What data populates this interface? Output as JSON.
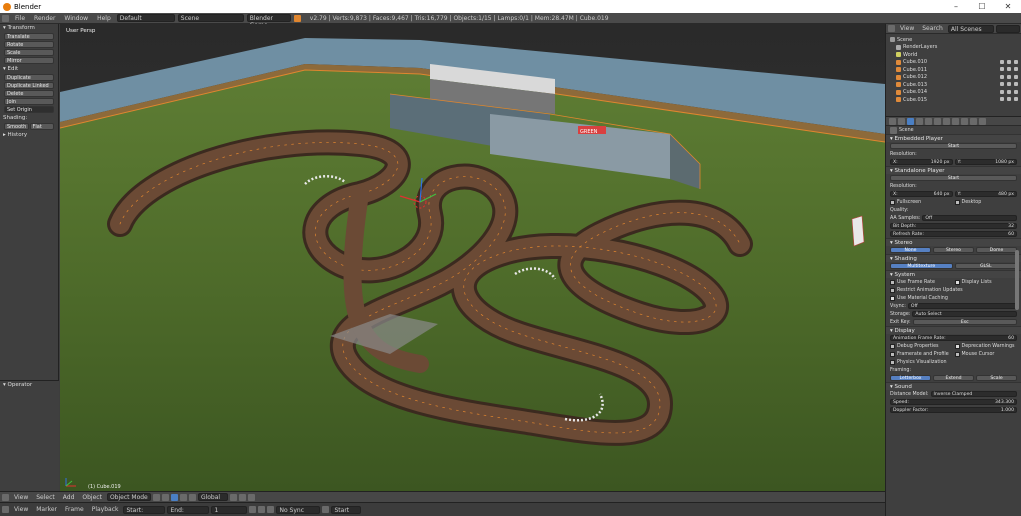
{
  "window": {
    "title": "Blender",
    "controls": [
      "–",
      "☐",
      "✕"
    ]
  },
  "infobar": {
    "menus": [
      "File",
      "Render",
      "Window",
      "Help"
    ],
    "layout": "Default",
    "scene": "Scene",
    "engine": "Blender Game",
    "stats": "v2.79 | Verts:9,873 | Faces:9,467 | Tris:16,779 | Objects:1/15 | Lamps:0/1 | Mem:28.47M | Cube.019"
  },
  "toolshelf": {
    "transform_header": "▾ Transform",
    "transform": [
      "Translate",
      "Rotate",
      "Scale",
      "Mirror"
    ],
    "edit_header": "▾ Edit",
    "edit": [
      "Duplicate",
      "Duplicate Linked",
      "Delete",
      "Join",
      "Set Origin"
    ],
    "shading_label": "Shading:",
    "shading": [
      "Smooth",
      "Flat"
    ],
    "history_header": "▸ History",
    "operator_header": "▾ Operator"
  },
  "viewport": {
    "label": "User Persp",
    "object": "(1) Cube.019",
    "banner": "GREEN"
  },
  "header": {
    "menus": [
      "View",
      "Select",
      "Add",
      "Object"
    ],
    "mode": "Object Mode",
    "pivot": "Global"
  },
  "timeline": {
    "menus": [
      "View",
      "Marker",
      "Frame",
      "Playback"
    ],
    "start": "Start:",
    "end": "End:",
    "sync": "No Sync",
    "keying": "Start",
    "frame": "1"
  },
  "outliner": {
    "menus": [
      "View",
      "Search"
    ],
    "filter": "All Scenes",
    "items": [
      {
        "label": "Scene",
        "indent": 0
      },
      {
        "label": "RenderLayers",
        "indent": 1
      },
      {
        "label": "World",
        "indent": 1
      },
      {
        "label": "Cube.010",
        "indent": 1
      },
      {
        "label": "Cube.011",
        "indent": 1
      },
      {
        "label": "Cube.012",
        "indent": 1
      },
      {
        "label": "Cube.013",
        "indent": 1
      },
      {
        "label": "Cube.014",
        "indent": 1
      },
      {
        "label": "Cube.015",
        "indent": 1
      }
    ]
  },
  "properties": {
    "breadcrumb": "Scene",
    "embedded_header": "▾ Embedded Player",
    "embedded_start": "Start",
    "resolution_label": "Resolution:",
    "res_x": "X:",
    "res_x_val": "1920 px",
    "res_y": "Y:",
    "res_y_val": "1080 px",
    "standalone_header": "▾ Standalone Player",
    "standalone_start": "Start",
    "res2_x_val": "640 px",
    "res2_y_val": "480 px",
    "fullscreen": "Fullscreen",
    "desktop": "Desktop",
    "quality_label": "Quality:",
    "aa_label": "AA Samples:",
    "aa_val": "Off",
    "bitdepth_label": "Bit Depth:",
    "bitdepth_val": "32",
    "refresh_label": "Refresh Rate:",
    "refresh_val": "60",
    "stereo_header": "▾ Stereo",
    "stereo_opts": [
      "None",
      "Stereo",
      "Dome"
    ],
    "shading_header": "▾ Shading",
    "shading_opts": [
      "Multitexture",
      "GLSL"
    ],
    "system_header": "▾ System",
    "use_frame_rate": "Use Frame Rate",
    "display_lists": "Display Lists",
    "restrict_anim": "Restrict Animation Updates",
    "use_mat_caching": "Use Material Caching",
    "vsync_label": "Vsync:",
    "vsync_val": "Off",
    "storage_label": "Storage:",
    "storage_val": "Auto Select",
    "exitkey_label": "Exit Key:",
    "exitkey_val": "Esc",
    "display_header": "▾ Display",
    "anim_frame_rate": "Animation Frame Rate:",
    "anim_frame_val": "60",
    "debug_props": "Debug Properties",
    "framerate_profile": "Framerate and Profile",
    "physics_vis": "Physics Visualization",
    "deprecation": "Deprecation Warnings",
    "mouse_cursor": "Mouse Cursor",
    "framing_label": "Framing:",
    "framing_opts": [
      "Letterbox",
      "Extend",
      "Scale"
    ],
    "sound_header": "▾ Sound",
    "distance_model_label": "Distance Model:",
    "distance_model_val": "Inverse Clamped",
    "speed_label": "Speed:",
    "speed_val": "343.300",
    "doppler_label": "Doppler Factor:",
    "doppler_val": "1.000"
  },
  "colors": {
    "accent": "#5680c2",
    "selection": "#e0862f",
    "grass": "#4e6b2a",
    "track": "#5a3a28"
  }
}
